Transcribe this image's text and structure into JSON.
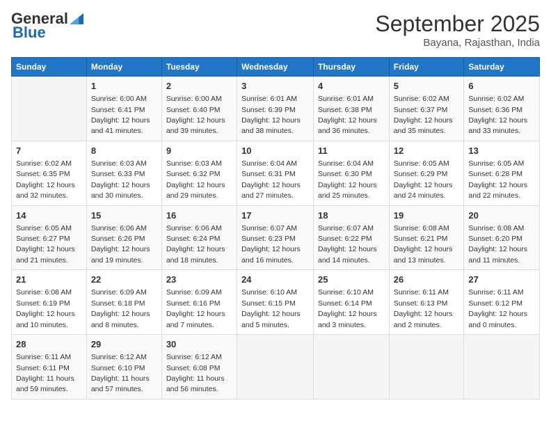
{
  "header": {
    "logo_general": "General",
    "logo_blue": "Blue",
    "month_title": "September 2025",
    "subtitle": "Bayana, Rajasthan, India"
  },
  "days_of_week": [
    "Sunday",
    "Monday",
    "Tuesday",
    "Wednesday",
    "Thursday",
    "Friday",
    "Saturday"
  ],
  "weeks": [
    [
      {
        "day": "",
        "sunrise": "",
        "sunset": "",
        "daylight": ""
      },
      {
        "day": "1",
        "sunrise": "Sunrise: 6:00 AM",
        "sunset": "Sunset: 6:41 PM",
        "daylight": "Daylight: 12 hours and 41 minutes."
      },
      {
        "day": "2",
        "sunrise": "Sunrise: 6:00 AM",
        "sunset": "Sunset: 6:40 PM",
        "daylight": "Daylight: 12 hours and 39 minutes."
      },
      {
        "day": "3",
        "sunrise": "Sunrise: 6:01 AM",
        "sunset": "Sunset: 6:39 PM",
        "daylight": "Daylight: 12 hours and 38 minutes."
      },
      {
        "day": "4",
        "sunrise": "Sunrise: 6:01 AM",
        "sunset": "Sunset: 6:38 PM",
        "daylight": "Daylight: 12 hours and 36 minutes."
      },
      {
        "day": "5",
        "sunrise": "Sunrise: 6:02 AM",
        "sunset": "Sunset: 6:37 PM",
        "daylight": "Daylight: 12 hours and 35 minutes."
      },
      {
        "day": "6",
        "sunrise": "Sunrise: 6:02 AM",
        "sunset": "Sunset: 6:36 PM",
        "daylight": "Daylight: 12 hours and 33 minutes."
      }
    ],
    [
      {
        "day": "7",
        "sunrise": "Sunrise: 6:02 AM",
        "sunset": "Sunset: 6:35 PM",
        "daylight": "Daylight: 12 hours and 32 minutes."
      },
      {
        "day": "8",
        "sunrise": "Sunrise: 6:03 AM",
        "sunset": "Sunset: 6:33 PM",
        "daylight": "Daylight: 12 hours and 30 minutes."
      },
      {
        "day": "9",
        "sunrise": "Sunrise: 6:03 AM",
        "sunset": "Sunset: 6:32 PM",
        "daylight": "Daylight: 12 hours and 29 minutes."
      },
      {
        "day": "10",
        "sunrise": "Sunrise: 6:04 AM",
        "sunset": "Sunset: 6:31 PM",
        "daylight": "Daylight: 12 hours and 27 minutes."
      },
      {
        "day": "11",
        "sunrise": "Sunrise: 6:04 AM",
        "sunset": "Sunset: 6:30 PM",
        "daylight": "Daylight: 12 hours and 25 minutes."
      },
      {
        "day": "12",
        "sunrise": "Sunrise: 6:05 AM",
        "sunset": "Sunset: 6:29 PM",
        "daylight": "Daylight: 12 hours and 24 minutes."
      },
      {
        "day": "13",
        "sunrise": "Sunrise: 6:05 AM",
        "sunset": "Sunset: 6:28 PM",
        "daylight": "Daylight: 12 hours and 22 minutes."
      }
    ],
    [
      {
        "day": "14",
        "sunrise": "Sunrise: 6:05 AM",
        "sunset": "Sunset: 6:27 PM",
        "daylight": "Daylight: 12 hours and 21 minutes."
      },
      {
        "day": "15",
        "sunrise": "Sunrise: 6:06 AM",
        "sunset": "Sunset: 6:26 PM",
        "daylight": "Daylight: 12 hours and 19 minutes."
      },
      {
        "day": "16",
        "sunrise": "Sunrise: 6:06 AM",
        "sunset": "Sunset: 6:24 PM",
        "daylight": "Daylight: 12 hours and 18 minutes."
      },
      {
        "day": "17",
        "sunrise": "Sunrise: 6:07 AM",
        "sunset": "Sunset: 6:23 PM",
        "daylight": "Daylight: 12 hours and 16 minutes."
      },
      {
        "day": "18",
        "sunrise": "Sunrise: 6:07 AM",
        "sunset": "Sunset: 6:22 PM",
        "daylight": "Daylight: 12 hours and 14 minutes."
      },
      {
        "day": "19",
        "sunrise": "Sunrise: 6:08 AM",
        "sunset": "Sunset: 6:21 PM",
        "daylight": "Daylight: 12 hours and 13 minutes."
      },
      {
        "day": "20",
        "sunrise": "Sunrise: 6:08 AM",
        "sunset": "Sunset: 6:20 PM",
        "daylight": "Daylight: 12 hours and 11 minutes."
      }
    ],
    [
      {
        "day": "21",
        "sunrise": "Sunrise: 6:08 AM",
        "sunset": "Sunset: 6:19 PM",
        "daylight": "Daylight: 12 hours and 10 minutes."
      },
      {
        "day": "22",
        "sunrise": "Sunrise: 6:09 AM",
        "sunset": "Sunset: 6:18 PM",
        "daylight": "Daylight: 12 hours and 8 minutes."
      },
      {
        "day": "23",
        "sunrise": "Sunrise: 6:09 AM",
        "sunset": "Sunset: 6:16 PM",
        "daylight": "Daylight: 12 hours and 7 minutes."
      },
      {
        "day": "24",
        "sunrise": "Sunrise: 6:10 AM",
        "sunset": "Sunset: 6:15 PM",
        "daylight": "Daylight: 12 hours and 5 minutes."
      },
      {
        "day": "25",
        "sunrise": "Sunrise: 6:10 AM",
        "sunset": "Sunset: 6:14 PM",
        "daylight": "Daylight: 12 hours and 3 minutes."
      },
      {
        "day": "26",
        "sunrise": "Sunrise: 6:11 AM",
        "sunset": "Sunset: 6:13 PM",
        "daylight": "Daylight: 12 hours and 2 minutes."
      },
      {
        "day": "27",
        "sunrise": "Sunrise: 6:11 AM",
        "sunset": "Sunset: 6:12 PM",
        "daylight": "Daylight: 12 hours and 0 minutes."
      }
    ],
    [
      {
        "day": "28",
        "sunrise": "Sunrise: 6:11 AM",
        "sunset": "Sunset: 6:11 PM",
        "daylight": "Daylight: 11 hours and 59 minutes."
      },
      {
        "day": "29",
        "sunrise": "Sunrise: 6:12 AM",
        "sunset": "Sunset: 6:10 PM",
        "daylight": "Daylight: 11 hours and 57 minutes."
      },
      {
        "day": "30",
        "sunrise": "Sunrise: 6:12 AM",
        "sunset": "Sunset: 6:08 PM",
        "daylight": "Daylight: 11 hours and 56 minutes."
      },
      {
        "day": "",
        "sunrise": "",
        "sunset": "",
        "daylight": ""
      },
      {
        "day": "",
        "sunrise": "",
        "sunset": "",
        "daylight": ""
      },
      {
        "day": "",
        "sunrise": "",
        "sunset": "",
        "daylight": ""
      },
      {
        "day": "",
        "sunrise": "",
        "sunset": "",
        "daylight": ""
      }
    ]
  ]
}
